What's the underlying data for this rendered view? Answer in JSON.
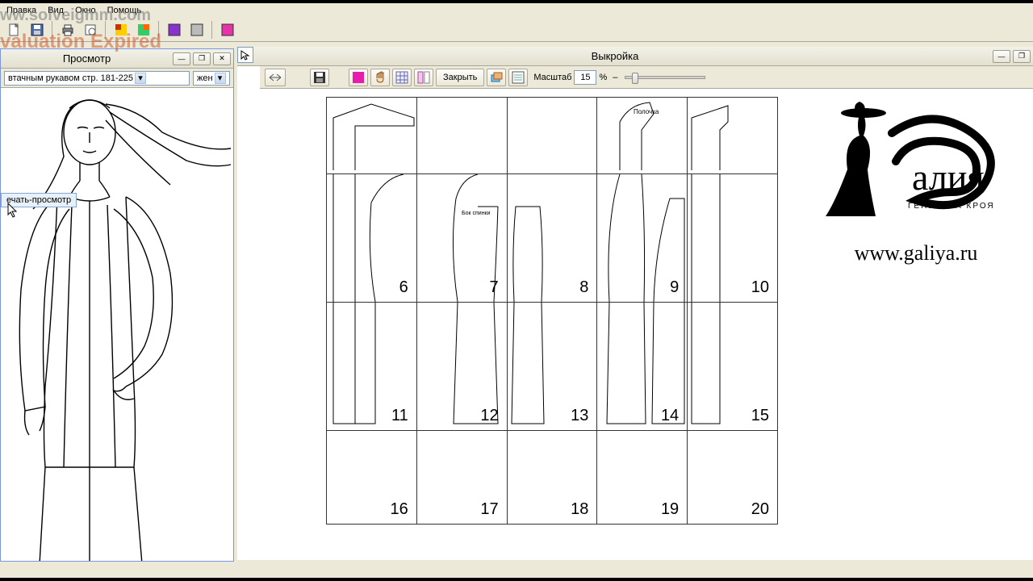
{
  "watermarks": {
    "url": "ww.solveigmm.com",
    "expired": "valuation Expired"
  },
  "menubar": {
    "items": [
      "Правка",
      "Вид",
      "Окно",
      "Помощь"
    ]
  },
  "preview": {
    "title": "Просмотр",
    "model_combo": "втачным рукавом стр. 181-225",
    "gender_combo": "жен",
    "tooltip": "ечать-просмотр"
  },
  "pattern": {
    "title": "Выкройка",
    "close_label": "Закрыть",
    "scale_label": "Масштаб",
    "scale_value": "15",
    "scale_unit": "%",
    "pages": {
      "r1": [
        "",
        "",
        "",
        "",
        ""
      ],
      "r2": [
        "6",
        "7",
        "8",
        "9",
        "10"
      ],
      "r3": [
        "11",
        "12",
        "13",
        "14",
        "15"
      ],
      "r4": [
        "16",
        "17",
        "18",
        "19",
        "20"
      ]
    },
    "small_label": "Полочка"
  },
  "brand": {
    "name": "алия",
    "tagline": "ГЕНЕТИКА КРОЯ",
    "url": "www.galiya.ru"
  }
}
